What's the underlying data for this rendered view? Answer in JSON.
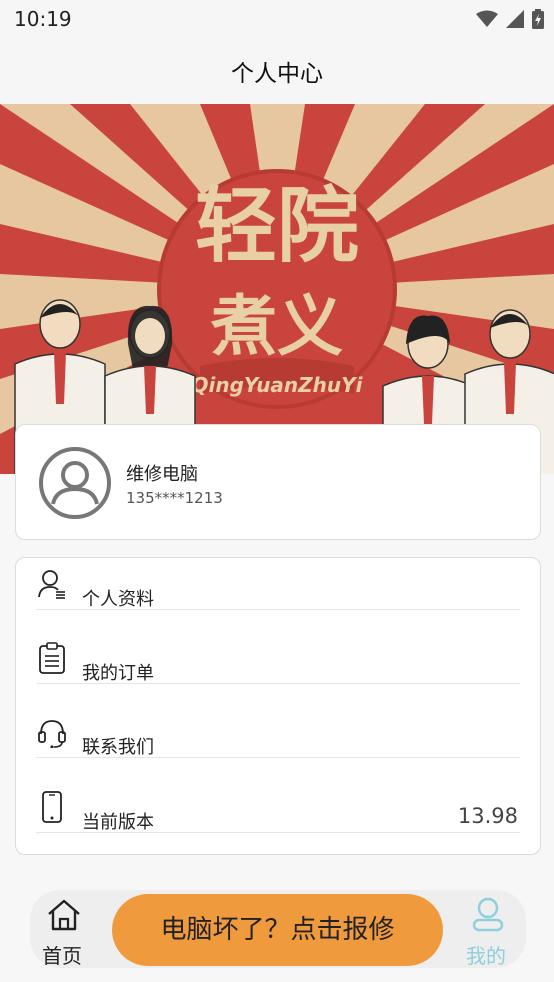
{
  "status_bar": {
    "time": "10:19",
    "icons": [
      "wifi-icon",
      "signal-icon",
      "battery-icon"
    ]
  },
  "header": {
    "title": "个人中心"
  },
  "banner": {
    "headline": "轻院",
    "subline": "煮义",
    "latin": "QingYuanZhuYi",
    "colors": {
      "red": "#c9443c",
      "cream": "#e8cfa6"
    }
  },
  "profile": {
    "name": "维修电脑",
    "phone": "135****1213",
    "avatar_icon": "user-avatar-icon"
  },
  "menu": {
    "items": [
      {
        "label": "个人资料",
        "icon": "profile-icon"
      },
      {
        "label": "我的订单",
        "icon": "clipboard-icon"
      },
      {
        "label": "联系我们",
        "icon": "headset-icon"
      },
      {
        "label": "当前版本",
        "icon": "phone-icon",
        "value": "13.98"
      }
    ]
  },
  "bottom_nav": {
    "home_label": "首页",
    "repair_label": "电脑坏了？点击报修",
    "mine_label": "我的",
    "colors": {
      "repair": "#f09a3e",
      "active": "#8ecfdc"
    }
  }
}
